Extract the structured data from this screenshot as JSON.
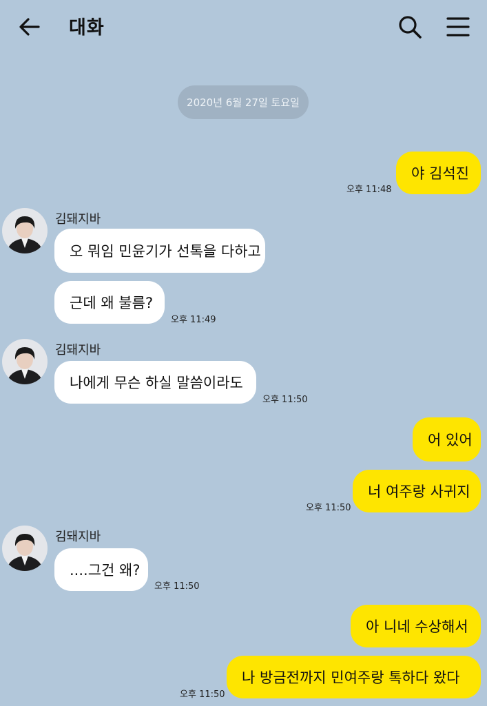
{
  "header": {
    "title": "대화",
    "back_icon": "arrow-left-icon",
    "search_icon": "search-icon",
    "menu_icon": "hamburger-menu-icon"
  },
  "date_divider": "2020년 6월 27일 토요일",
  "colors": {
    "background": "#b2c7da",
    "my_bubble": "#fee500",
    "their_bubble": "#ffffff",
    "date_pill": "#a0b2c3"
  },
  "messages": [
    {
      "sender": "me",
      "text": "야 김석진",
      "time": "오후 11:48"
    },
    {
      "sender": "김돼지바",
      "text": "오 뭐임 민윤기가 선톡을 다하고"
    },
    {
      "sender": "김돼지바",
      "text": "근데 왜 불름?",
      "time": "오후 11:49"
    },
    {
      "sender": "김돼지바",
      "text": "나에게 무슨 하실 말씀이라도",
      "time": "오후 11:50"
    },
    {
      "sender": "me",
      "text": "어 있어"
    },
    {
      "sender": "me",
      "text": "너 여주랑 사귀지",
      "time": "오후 11:50"
    },
    {
      "sender": "김돼지바",
      "text": "....그건 왜?",
      "time": "오후 11:50"
    },
    {
      "sender": "me",
      "text": "아 니네 수상해서"
    },
    {
      "sender": "me",
      "text": "나 방금전까지 민여주랑 톡하다 왔다",
      "time": "오후 11:50"
    }
  ]
}
